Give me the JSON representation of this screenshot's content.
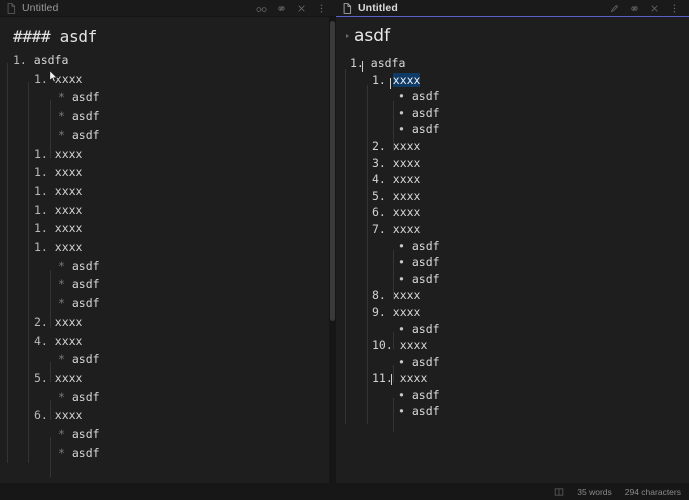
{
  "accent_color": "#5a5fc7",
  "selection_color": "#0f3a66",
  "background_color": "#1e1e1e",
  "left_pane": {
    "title": "Untitled",
    "file_icon": "document-icon",
    "active": false,
    "mode": "source",
    "actions": [
      {
        "name": "reading-view-icon",
        "label": "Reading view"
      },
      {
        "name": "link-icon",
        "label": "Link"
      },
      {
        "name": "close-icon",
        "label": "Close"
      },
      {
        "name": "more-options-icon",
        "label": "More options"
      }
    ],
    "heading": "#### asdf",
    "lines": [
      {
        "indent": 0,
        "marker": "1.",
        "text": "asdfa"
      },
      {
        "indent": 1,
        "marker": "1.",
        "text": "xxxx"
      },
      {
        "indent": 2,
        "marker": "*",
        "text": "asdf"
      },
      {
        "indent": 2,
        "marker": "*",
        "text": "asdf"
      },
      {
        "indent": 2,
        "marker": "*",
        "text": "asdf"
      },
      {
        "indent": 1,
        "marker": "1.",
        "text": "xxxx"
      },
      {
        "indent": 1,
        "marker": "1.",
        "text": "xxxx"
      },
      {
        "indent": 1,
        "marker": "1.",
        "text": "xxxx"
      },
      {
        "indent": 1,
        "marker": "1.",
        "text": "xxxx"
      },
      {
        "indent": 1,
        "marker": "1.",
        "text": "xxxx"
      },
      {
        "indent": 1,
        "marker": "1.",
        "text": "xxxx"
      },
      {
        "indent": 2,
        "marker": "*",
        "text": "asdf"
      },
      {
        "indent": 2,
        "marker": "*",
        "text": "asdf"
      },
      {
        "indent": 2,
        "marker": "*",
        "text": "asdf"
      },
      {
        "indent": 1,
        "marker": "2.",
        "text": "xxxx"
      },
      {
        "indent": 1,
        "marker": "4.",
        "text": "xxxx"
      },
      {
        "indent": 2,
        "marker": "*",
        "text": "asdf"
      },
      {
        "indent": 1,
        "marker": "5.",
        "text": "xxxx"
      },
      {
        "indent": 2,
        "marker": "*",
        "text": "asdf"
      },
      {
        "indent": 1,
        "marker": "6.",
        "text": "xxxx"
      },
      {
        "indent": 2,
        "marker": "*",
        "text": "asdf"
      },
      {
        "indent": 2,
        "marker": "*",
        "text": "asdf"
      }
    ]
  },
  "right_pane": {
    "title": "Untitled",
    "file_icon": "document-icon",
    "active": true,
    "mode": "reading",
    "actions": [
      {
        "name": "edit-pencil-icon",
        "label": "Edit"
      },
      {
        "name": "link-icon",
        "label": "Link"
      },
      {
        "name": "close-icon",
        "label": "Close"
      },
      {
        "name": "more-options-icon",
        "label": "More options"
      }
    ],
    "heading": "asdf",
    "items": [
      {
        "indent": 0,
        "marker": "1.",
        "text": "asdfa",
        "selected": false
      },
      {
        "indent": 1,
        "marker": "1.",
        "text": "xxxx",
        "selected": true
      },
      {
        "indent": 2,
        "marker": "•",
        "text": "asdf",
        "selected": false
      },
      {
        "indent": 2,
        "marker": "•",
        "text": "asdf",
        "selected": false
      },
      {
        "indent": 2,
        "marker": "•",
        "text": "asdf",
        "selected": false
      },
      {
        "indent": 1,
        "marker": "2.",
        "text": "xxxx",
        "selected": false
      },
      {
        "indent": 1,
        "marker": "3.",
        "text": "xxxx",
        "selected": false
      },
      {
        "indent": 1,
        "marker": "4.",
        "text": "xxxx",
        "selected": false
      },
      {
        "indent": 1,
        "marker": "5.",
        "text": "xxxx",
        "selected": false
      },
      {
        "indent": 1,
        "marker": "6.",
        "text": "xxxx",
        "selected": false
      },
      {
        "indent": 1,
        "marker": "7.",
        "text": "xxxx",
        "selected": false
      },
      {
        "indent": 2,
        "marker": "•",
        "text": "asdf",
        "selected": false
      },
      {
        "indent": 2,
        "marker": "•",
        "text": "asdf",
        "selected": false
      },
      {
        "indent": 2,
        "marker": "•",
        "text": "asdf",
        "selected": false
      },
      {
        "indent": 1,
        "marker": "8.",
        "text": "xxxx",
        "selected": false
      },
      {
        "indent": 1,
        "marker": "9.",
        "text": "xxxx",
        "selected": false
      },
      {
        "indent": 2,
        "marker": "•",
        "text": "asdf",
        "selected": false
      },
      {
        "indent": 1,
        "marker": "10.",
        "text": "xxxx",
        "selected": false
      },
      {
        "indent": 2,
        "marker": "•",
        "text": "asdf",
        "selected": false
      },
      {
        "indent": 1,
        "marker": "11.",
        "text": "xxxx",
        "selected": false
      },
      {
        "indent": 2,
        "marker": "•",
        "text": "asdf",
        "selected": false
      },
      {
        "indent": 2,
        "marker": "•",
        "text": "asdf",
        "selected": false
      }
    ]
  },
  "status_bar": {
    "reading_icon": "book-open-icon",
    "word_count": "35 words",
    "character_count": "294 characters"
  }
}
